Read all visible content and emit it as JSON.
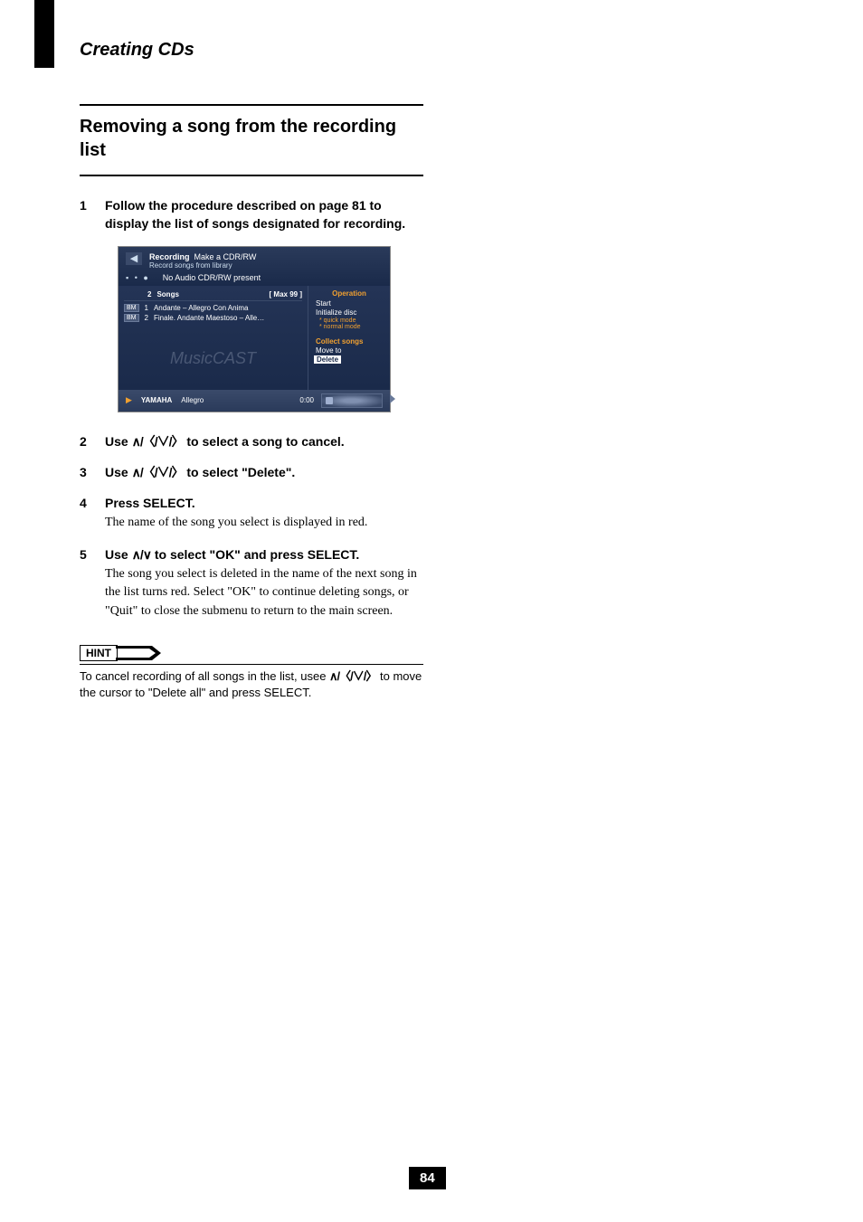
{
  "chapter_title": "Creating CDs",
  "section_title": "Removing a song from the recording list",
  "page_number": "84",
  "steps": [
    {
      "num": "1",
      "head": "Follow the procedure described on page 81 to display the list of songs designated for recording.",
      "sub": ""
    },
    {
      "num": "2",
      "head_pre": "Use ",
      "head_arrows": "∧/〈/∨/〉",
      "head_post": " to select a song to cancel.",
      "sub": ""
    },
    {
      "num": "3",
      "head_pre": "Use ",
      "head_arrows": "∧/〈/∨/〉",
      "head_post": " to select \"Delete\".",
      "sub": ""
    },
    {
      "num": "4",
      "head": "Press SELECT.",
      "sub": "The name of the song you select is displayed in red."
    },
    {
      "num": "5",
      "head_pre": "Use ",
      "head_arrows": "∧/∨",
      "head_post": " to select \"OK\" and press SELECT.",
      "sub": "The song you select is deleted in the name of the next song in the list turns red. Select \"OK\" to continue deleting songs, or \"Quit\" to close the submenu to return to the main screen."
    }
  ],
  "hint": {
    "label": "HINT",
    "text_pre": "To cancel recording of all songs in the list, usee ",
    "arrows": "∧/〈/∨/〉",
    "text_post": " to move the cursor to \"Delete all\" and press SELECT."
  },
  "ui": {
    "header": {
      "title_label": "Recording",
      "title_main": "Make a CDR/RW",
      "subtitle": "Record songs from library",
      "status": "No Audio CDR/RW present"
    },
    "list": {
      "count": "2",
      "count_label": "Songs",
      "max": "[ Max 99 ]",
      "rows": [
        {
          "badge": "BM",
          "n": "1",
          "text": "Andante – Allegro Con Anima"
        },
        {
          "badge": "BM",
          "n": "2",
          "text": "Finale. Andante Maestoso – Alle…"
        }
      ],
      "watermark": "MusicCAST"
    },
    "ops": {
      "head": "Operation",
      "items": {
        "start": "Start",
        "initialize": "Initialize disc",
        "quick": "* quick mode",
        "normal": "* normal mode",
        "collect": "Collect songs",
        "move": "Move to",
        "delete": "Delete"
      }
    },
    "footer": {
      "brand": "YAMAHA",
      "track": "Allegro",
      "time": "0:00"
    }
  }
}
